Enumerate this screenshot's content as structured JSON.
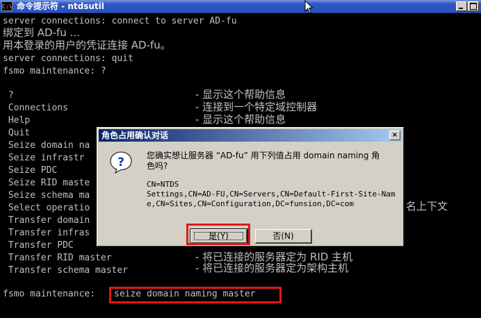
{
  "window": {
    "title": "命令提示符 - ntdsutil",
    "icon_label": "C:\\",
    "buttons": [
      "minimize-icon",
      "maximize-icon"
    ]
  },
  "console": {
    "lines": [
      "server connections: connect to server AD-fu",
      "绑定到 AD-fu ...",
      "用本登录的用户的凭证连接 AD-fu。",
      "server connections: quit",
      "fsmo maintenance: ?",
      " ?",
      " Connections",
      " Help",
      " Quit",
      " Seize domain na",
      " Seize infrastr",
      " Seize PDC",
      " Seize RID maste",
      " Seize schema ma",
      " Select operatio",
      " Transfer domain",
      " Transfer infras",
      " Transfer PDC",
      " Transfer RID master",
      " Transfer schema master",
      "fsmo maintenance: ",
      "seize domain naming master"
    ],
    "descriptions": {
      "help_q": "- 显示这个帮助信息",
      "connections": "- 连接到一个特定域控制器",
      "help": "- 显示这个帮助信息",
      "select_tail": "名上下文",
      "transfer_rid": "- 将已连接的服务器定为 RID 主机",
      "transfer_schema": "- 将已连接的服务器定为架构主机"
    },
    "highlight_color": "#e01818"
  },
  "dialog": {
    "title": "角色占用确认对话",
    "message_line1": "您确实想让服务器 “AD-fu” 用下列值占用 domain naming 角",
    "message_line2": "色吗?",
    "dn_line1": "CN=NTDS",
    "dn_line2": "Settings,CN=AD-FU,CN=Servers,CN=Default-First-Site-Nam",
    "dn_line3": "e,CN=Sites,CN=Configuration,DC=funsion,DC=com",
    "yes_label": "是(Y)",
    "no_label": "否(N)",
    "close_glyph": "×"
  }
}
